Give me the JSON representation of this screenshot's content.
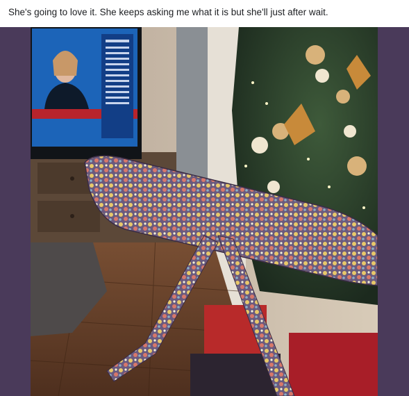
{
  "post": {
    "caption": "She's going to love it. She keeps asking me what it is but she'll just after wait."
  },
  "colors": {
    "frame_background": "#4a3a5a",
    "caption_text": "#1c1e21"
  }
}
